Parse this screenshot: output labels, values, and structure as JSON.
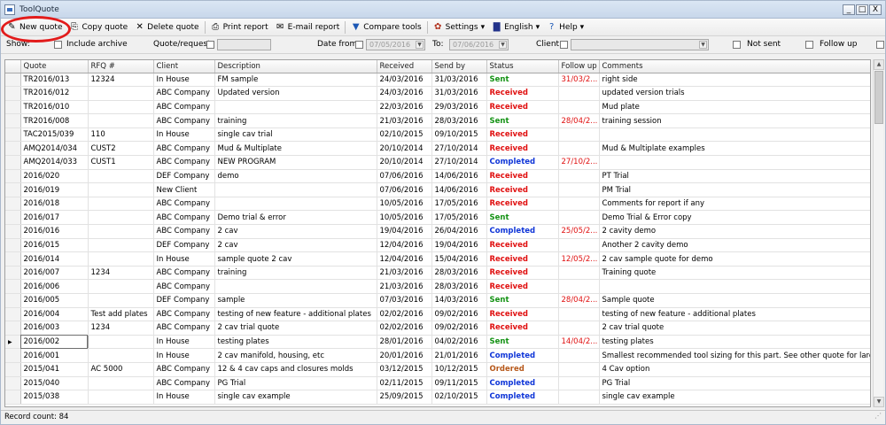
{
  "window": {
    "title": "ToolQuote",
    "controls": [
      "_",
      "□",
      "X"
    ]
  },
  "toolbar": {
    "new_quote": "New quote",
    "copy_quote": "Copy quote",
    "delete_quote": "Delete quote",
    "print_report": "Print report",
    "email_report": "E-mail report",
    "compare_tools": "Compare tools",
    "settings": "Settings",
    "language": "English",
    "help": "Help"
  },
  "filters": {
    "show": "Show:",
    "include_archive": "Include archive",
    "quote_request": "Quote/request:",
    "date_from": "Date from:",
    "date_from_value": "07/05/2016",
    "to": "To:",
    "date_to_value": "07/06/2016",
    "client": "Client:",
    "not_sent": "Not sent",
    "follow_up": "Follow up"
  },
  "grid": {
    "columns": [
      "Quote",
      "RFQ #",
      "Client",
      "Description",
      "Received",
      "Send by",
      "Status",
      "Follow up",
      "Comments"
    ],
    "rows": [
      [
        "TR2016/013",
        "12324",
        "In House",
        "FM sample",
        "24/03/2016",
        "31/03/2016",
        "Sent",
        "31/03/2...",
        "right side"
      ],
      [
        "TR2016/012",
        "",
        "ABC Company",
        "Updated version",
        "24/03/2016",
        "31/03/2016",
        "Received",
        "",
        "updated version trials"
      ],
      [
        "TR2016/010",
        "",
        "ABC Company",
        "",
        "22/03/2016",
        "29/03/2016",
        "Received",
        "",
        "Mud plate"
      ],
      [
        "TR2016/008",
        "",
        "ABC Company",
        "training",
        "21/03/2016",
        "28/03/2016",
        "Sent",
        "28/04/2...",
        "training session"
      ],
      [
        "TAC2015/039",
        "110",
        "In House",
        "single cav trial",
        "02/10/2015",
        "09/10/2015",
        "Received",
        "",
        ""
      ],
      [
        "AMQ2014/034",
        "CUST2",
        "ABC Company",
        "Mud & Multiplate",
        "20/10/2014",
        "27/10/2014",
        "Received",
        "",
        "Mud & Multiplate examples"
      ],
      [
        "AMQ2014/033",
        "CUST1",
        "ABC Company",
        "NEW PROGRAM",
        "20/10/2014",
        "27/10/2014",
        "Completed",
        "27/10/2...",
        ""
      ],
      [
        "2016/020",
        "",
        "DEF Company",
        "demo",
        "07/06/2016",
        "14/06/2016",
        "Received",
        "",
        "PT Trial"
      ],
      [
        "2016/019",
        "",
        "New Client",
        "",
        "07/06/2016",
        "14/06/2016",
        "Received",
        "",
        "PM Trial"
      ],
      [
        "2016/018",
        "",
        "ABC Company",
        "",
        "10/05/2016",
        "17/05/2016",
        "Received",
        "",
        "Comments for report if any"
      ],
      [
        "2016/017",
        "",
        "ABC Company",
        "Demo trial & error",
        "10/05/2016",
        "17/05/2016",
        "Sent",
        "",
        "Demo Trial & Error copy"
      ],
      [
        "2016/016",
        "",
        "ABC Company",
        "2 cav",
        "19/04/2016",
        "26/04/2016",
        "Completed",
        "25/05/2...",
        "2 cavity demo"
      ],
      [
        "2016/015",
        "",
        "DEF Company",
        "2 cav",
        "12/04/2016",
        "19/04/2016",
        "Received",
        "",
        "Another 2 cavity demo"
      ],
      [
        "2016/014",
        "",
        "In House",
        "sample quote 2 cav",
        "12/04/2016",
        "15/04/2016",
        "Received",
        "12/05/2...",
        "2 cav sample quote for demo"
      ],
      [
        "2016/007",
        "1234",
        "ABC Company",
        "training",
        "21/03/2016",
        "28/03/2016",
        "Received",
        "",
        "Training quote"
      ],
      [
        "2016/006",
        "",
        "ABC Company",
        "",
        "21/03/2016",
        "28/03/2016",
        "Received",
        "",
        ""
      ],
      [
        "2016/005",
        "",
        "DEF Company",
        "sample",
        "07/03/2016",
        "14/03/2016",
        "Sent",
        "28/04/2...",
        "Sample quote"
      ],
      [
        "2016/004",
        "Test add plates",
        "ABC Company",
        "testing of new feature - additional plates",
        "02/02/2016",
        "09/02/2016",
        "Received",
        "",
        "testing of new feature - additional plates"
      ],
      [
        "2016/003",
        "1234",
        "ABC Company",
        "2 cav trial quote",
        "02/02/2016",
        "09/02/2016",
        "Received",
        "",
        "2 cav trial quote"
      ],
      [
        "2016/002",
        "",
        "In House",
        "testing plates",
        "28/01/2016",
        "04/02/2016",
        "Sent",
        "14/04/2...",
        "testing plates"
      ],
      [
        "2016/001",
        "",
        "In House",
        "2 cav manifold, housing, etc",
        "20/01/2016",
        "21/01/2016",
        "Completed",
        "",
        "Smallest recommended  tool sizing for this part. See other quote for larger recom..."
      ],
      [
        "2015/041",
        "AC 5000",
        "ABC Company",
        "12 & 4 cav caps and closures molds",
        "03/12/2015",
        "10/12/2015",
        "Ordered",
        "",
        "4 Cav option"
      ],
      [
        "2015/040",
        "",
        "ABC Company",
        "PG Trial",
        "02/11/2015",
        "09/11/2015",
        "Completed",
        "",
        "PG Trial"
      ],
      [
        "2015/038",
        "",
        "In House",
        "single cav example",
        "25/09/2015",
        "02/10/2015",
        "Completed",
        "",
        "single cav example"
      ]
    ],
    "selected_row_index": 19,
    "status_colors": {
      "Sent": "#149214",
      "Received": "#e01010",
      "Completed": "#1036d8",
      "Ordered": "#b6581a"
    }
  },
  "statusbar": {
    "record_count": "Record count: 84"
  }
}
